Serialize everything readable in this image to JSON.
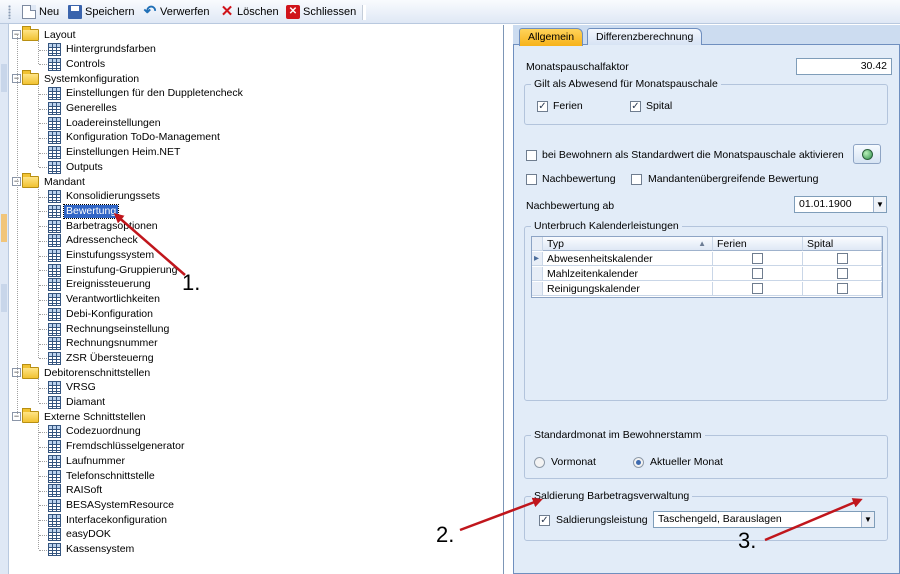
{
  "toolbar": {
    "new_label": "Neu",
    "save_label": "Speichern",
    "discard_label": "Verwerfen",
    "delete_label": "Löschen",
    "close_label": "Schliessen"
  },
  "tree": {
    "nodes": [
      {
        "label": "Layout",
        "type": "folder",
        "expand": "−"
      },
      {
        "label": "Hintergrundsfarben",
        "type": "grid"
      },
      {
        "label": "Controls",
        "type": "grid"
      },
      {
        "label": "Systemkonfiguration",
        "type": "folder",
        "expand": "−"
      },
      {
        "label": "Einstellungen für den Duppletencheck",
        "type": "grid"
      },
      {
        "label": "Generelles",
        "type": "grid"
      },
      {
        "label": "Loadereinstellungen",
        "type": "grid"
      },
      {
        "label": "Konfiguration ToDo-Management",
        "type": "grid"
      },
      {
        "label": "Einstellungen Heim.NET",
        "type": "grid"
      },
      {
        "label": "Outputs",
        "type": "grid"
      },
      {
        "label": "Mandant",
        "type": "folder",
        "expand": "−"
      },
      {
        "label": "Konsolidierungssets",
        "type": "grid"
      },
      {
        "label": "Bewertung",
        "type": "grid",
        "selected": true
      },
      {
        "label": "Barbetragsoptionen",
        "type": "grid"
      },
      {
        "label": "Adressencheck",
        "type": "grid"
      },
      {
        "label": "Einstufungssystem",
        "type": "grid"
      },
      {
        "label": "Einstufung-Gruppierung",
        "type": "grid"
      },
      {
        "label": "Ereignissteuerung",
        "type": "grid"
      },
      {
        "label": "Verantwortlichkeiten",
        "type": "grid"
      },
      {
        "label": "Debi-Konfiguration",
        "type": "grid"
      },
      {
        "label": "Rechnungseinstellung",
        "type": "grid"
      },
      {
        "label": "Rechnungsnummer",
        "type": "grid"
      },
      {
        "label": "ZSR Übersteuerng",
        "type": "grid"
      },
      {
        "label": "Debitorenschnittstellen",
        "type": "folder",
        "expand": "−"
      },
      {
        "label": "VRSG",
        "type": "grid"
      },
      {
        "label": "Diamant",
        "type": "grid"
      },
      {
        "label": "Externe Schnittstellen",
        "type": "folder",
        "expand": "−"
      },
      {
        "label": "Codezuordnung",
        "type": "grid"
      },
      {
        "label": "Fremdschlüsselgenerator",
        "type": "grid"
      },
      {
        "label": "Laufnummer",
        "type": "grid"
      },
      {
        "label": "Telefonschnittstelle",
        "type": "grid"
      },
      {
        "label": "RAISoft",
        "type": "grid"
      },
      {
        "label": "BESASystemResource",
        "type": "grid"
      },
      {
        "label": "Interfacekonfiguration",
        "type": "grid"
      },
      {
        "label": "easyDOK",
        "type": "grid"
      },
      {
        "label": "Kassensystem",
        "type": "grid"
      }
    ]
  },
  "tabs": {
    "general": "Allgemein",
    "diff": "Differenzberechnung"
  },
  "form": {
    "monthly_factor_label": "Monatspauschalfaktor",
    "monthly_factor_value": "30.42",
    "absent_group_title": "Gilt als Abwesend für Monatspauschale",
    "holidays_label": "Ferien",
    "holidays_checked": "✓",
    "hospital_label": "Spital",
    "hospital_checked": "✓",
    "default_monthly_label": "bei Bewohnern als Standardwert die Monatspauschale aktivieren",
    "post_eval_label": "Nachbewertung",
    "cross_client_label": "Mandantenübergreifende Bewertung",
    "post_eval_from_label": "Nachbewertung ab",
    "post_eval_from_value": "01.01.1900",
    "interrupt_group_title": "Unterbruch Kalenderleistungen",
    "table_headers": [
      "Typ",
      "Ferien",
      "Spital"
    ],
    "table_rows": [
      {
        "typ": "Abwesenheitskalender"
      },
      {
        "typ": "Mahlzeitenkalender"
      },
      {
        "typ": "Reinigungskalender"
      }
    ],
    "std_month_group_title": "Standardmonat im Bewohnerstamm",
    "prev_month_label": "Vormonat",
    "current_month_label": "Aktueller Monat",
    "balance_group_title": "Saldierung Barbetragsverwaltung",
    "balance_label": "Saldierungsleistung",
    "balance_checked": "✓",
    "balance_select_value": "Taschengeld, Barauslagen"
  },
  "annotations": {
    "one": "1.",
    "two": "2.",
    "three": "3."
  },
  "colors": {
    "accent_tab": "#f7b21a",
    "selection": "#3166c6",
    "panel_bg": "#e2ecf8",
    "annotation_arrow": "#c0161c"
  }
}
